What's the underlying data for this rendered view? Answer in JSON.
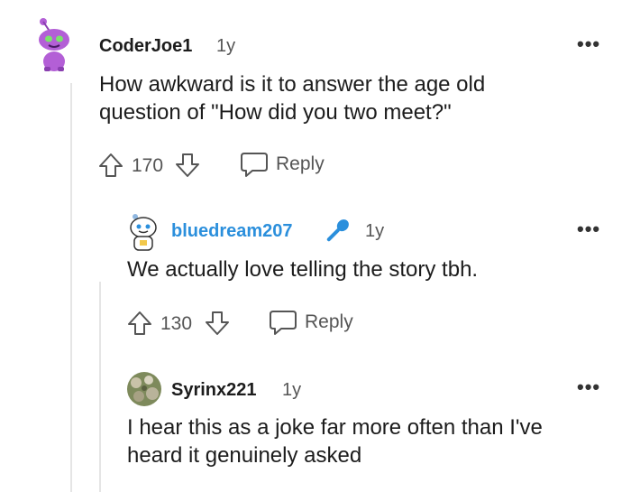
{
  "colors": {
    "accent_blue": "#2b8fdc",
    "text": "#1c1c1c",
    "meta": "#555555",
    "thread_line": "#e5e5e5"
  },
  "comments": [
    {
      "username": "CoderJoe1",
      "age": "1y",
      "body_lines": [
        "How awkward is it to answer the age old",
        "question of \"How did you two meet?\""
      ],
      "votes": "170",
      "reply_label": "Reply",
      "avatar_icon": "snoo-avatar-purple-icon",
      "more_label": "•••"
    },
    {
      "username": "bluedream207",
      "age": "1y",
      "flair_icon": "microphone-icon",
      "body_lines": [
        "We actually love telling the story tbh."
      ],
      "votes": "130",
      "reply_label": "Reply",
      "avatar_icon": "snoo-avatar-white-icon",
      "more_label": "•••"
    },
    {
      "username": "Syrinx221",
      "age": "1y",
      "body_lines": [
        "I hear this as a joke far more often than I've",
        "heard it genuinely asked"
      ],
      "avatar_icon": "photo-avatar-flowers-icon",
      "more_label": "•••"
    }
  ]
}
